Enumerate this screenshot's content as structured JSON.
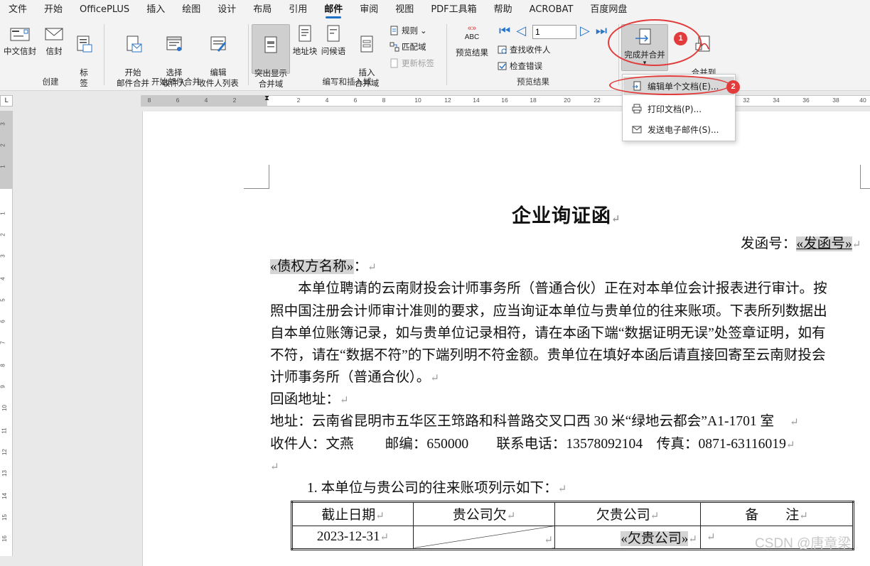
{
  "menu": {
    "tabs": [
      "文件",
      "开始",
      "OfficePLUS",
      "插入",
      "绘图",
      "设计",
      "布局",
      "引用",
      "邮件",
      "审阅",
      "视图",
      "PDF工具箱",
      "帮助",
      "ACROBAT",
      "百度网盘"
    ],
    "active": "邮件"
  },
  "ribbon": {
    "create": {
      "label": "创建",
      "chinese_envelope": "中文信封",
      "envelopes": "信封",
      "labels": "标\n签"
    },
    "start_merge": {
      "label": "开始邮件合并",
      "start": "开始\n邮件合并",
      "select": "选择\n收件人",
      "edit": "编辑\n收件人列表"
    },
    "write_insert": {
      "label": "编写和插入域",
      "highlight": "突出显示\n合并域",
      "address_block": "地址块",
      "greeting": "问候语",
      "insert_field": "插入\n合并域",
      "rules": "规则",
      "match_fields": "匹配域",
      "update_labels": "更新标签"
    },
    "preview": {
      "label": "预览结果",
      "preview_results": "预览结果",
      "abc": "ABC",
      "record_number": "1",
      "find_recipient": "查找收件人",
      "check_errors": "检查错误"
    },
    "finish": {
      "finish_merge": "完成并合并",
      "merge_pdf": "合并到\nAdobe PDF"
    }
  },
  "dropdown": {
    "items": [
      "编辑单个文档(E)...",
      "打印文档(P)...",
      "发送电子邮件(S)..."
    ]
  },
  "badges": [
    "1",
    "2"
  ],
  "ruler": {
    "h_left": [
      "8",
      "6",
      "4",
      "2"
    ],
    "h_right": [
      "2",
      "4",
      "6",
      "8",
      "10",
      "12",
      "14",
      "16",
      "18",
      "20",
      "22",
      "32",
      "34",
      "36",
      "38",
      "40"
    ],
    "v_top": [
      "3",
      "2",
      "1"
    ],
    "v_body": [
      "1",
      "2",
      "3",
      "4",
      "5",
      "6",
      "7",
      "8",
      "9",
      "10",
      "11",
      "12",
      "13",
      "14",
      "15",
      "16"
    ],
    "corner": "L"
  },
  "document": {
    "title": "企业询证函",
    "ref_label": "发函号：",
    "ref_field": "«发函号»",
    "creditor_field": "«债权方名称»",
    "creditor_suffix": "：",
    "para_lines": [
      "　　本单位聘请的云南财投会计师事务所（普通合伙）正在对本单位会计报表进行审计。按",
      "照中国注册会计师审计准则的要求，应当询证本单位与贵单位的往来账项。下表所列数据出",
      "自本单位账簿记录，如与贵单位记录相符，请在本函下端“数据证明无误”处签章证明，如有",
      "不符，请在“数据不符”的下端列明不符金额。贵单位在填好本函后请直接回寄至云南财投会",
      "计师事务所（普通合伙）。"
    ],
    "reply_label": "回函地址：",
    "address_line": "地址：云南省昆明市五华区王筇路和科普路交叉口西 30 米“绿地云都会”A1-1701 室",
    "contact_line": "收件人：文燕　　 邮编：650000　　联系电话：13578092104　传真：0871-63116019",
    "list_item": "1. 本单位与贵公司的往来账项列示如下：",
    "table": {
      "headers": [
        "截止日期",
        "贵公司欠",
        "欠贵公司",
        "备　　注"
      ],
      "row": [
        "2023-12-31",
        "",
        "«欠贵公司»",
        ""
      ]
    },
    "para_mark": "↵"
  },
  "watermark": "CSDN @唐章梁"
}
